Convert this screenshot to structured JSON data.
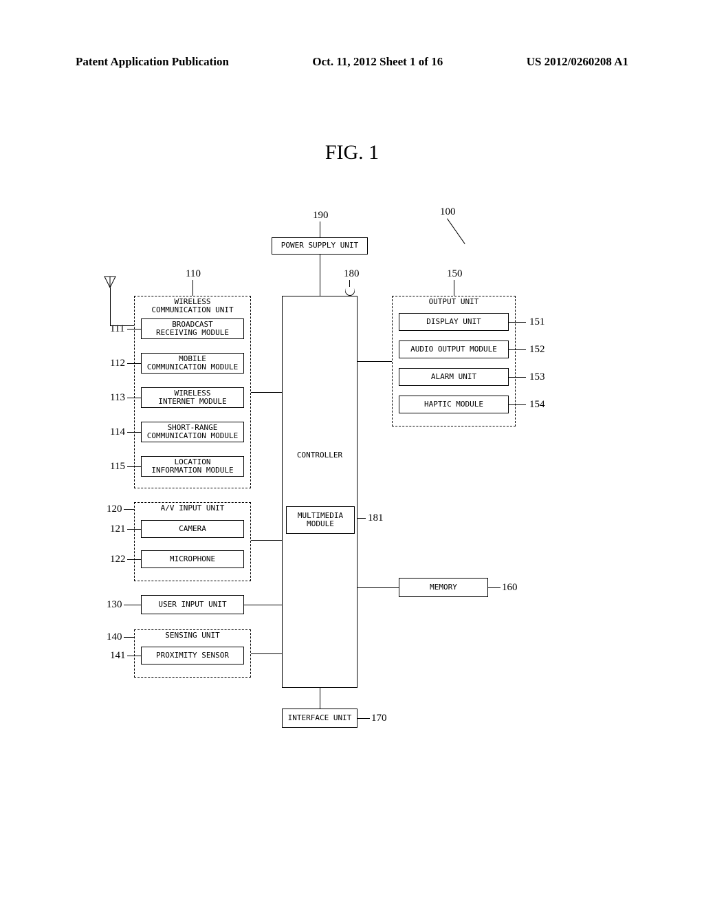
{
  "header": {
    "left": "Patent Application Publication",
    "middle": "Oct. 11, 2012   Sheet 1 of 16",
    "right": "US 2012/0260208 A1"
  },
  "figure_title": "FIG.  1",
  "refs": {
    "r190": "190",
    "r100": "100",
    "r110": "110",
    "r180": "180",
    "r150": "150",
    "r111": "111",
    "r112": "112",
    "r113": "113",
    "r114": "114",
    "r115": "115",
    "r120": "120",
    "r121": "121",
    "r122": "122",
    "r130": "130",
    "r140": "140",
    "r141": "141",
    "r151": "151",
    "r152": "152",
    "r153": "153",
    "r154": "154",
    "r181": "181",
    "r160": "160",
    "r170": "170"
  },
  "blocks": {
    "power_supply": "POWER SUPPLY UNIT",
    "wireless_unit": "WIRELESS\nCOMMUNICATION UNIT",
    "broadcast": "BROADCAST\nRECEIVING MODULE",
    "mobile_comm": "MOBILE\nCOMMUNICATION MODULE",
    "wireless_internet": "WIRELESS\nINTERNET MODULE",
    "short_range": "SHORT-RANGE\nCOMMUNICATION MODULE",
    "location": "LOCATION\nINFORMATION MODULE",
    "av_input": "A/V INPUT UNIT",
    "camera": "CAMERA",
    "microphone": "MICROPHONE",
    "user_input": "USER INPUT UNIT",
    "sensing_unit": "SENSING UNIT",
    "proximity": "PROXIMITY SENSOR",
    "controller": "CONTROLLER",
    "multimedia": "MULTIMEDIA\nMODULE",
    "interface": "INTERFACE UNIT",
    "output_unit": "OUTPUT UNIT",
    "display": "DISPLAY UNIT",
    "audio_out": "AUDIO OUTPUT MODULE",
    "alarm": "ALARM UNIT",
    "haptic": "HAPTIC MODULE",
    "memory": "MEMORY"
  }
}
